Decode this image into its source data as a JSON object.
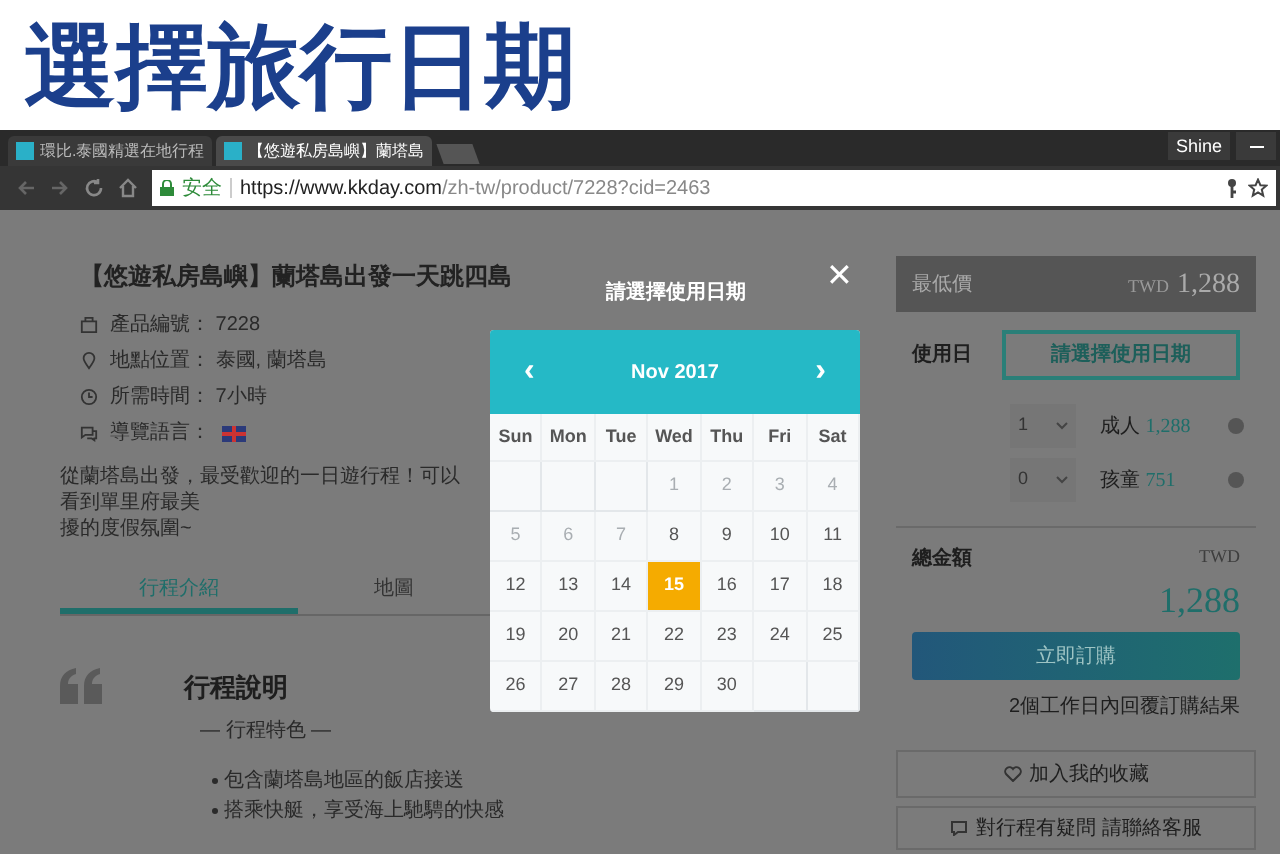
{
  "heading": "選擇旅行日期",
  "browser": {
    "tabs": [
      {
        "title": "環比.泰國精選在地行程",
        "selected": false
      },
      {
        "title": "【悠遊私房島嶼】蘭塔島",
        "selected": true
      }
    ],
    "profile": "Shine",
    "security_label": "安全",
    "url_host": "https://www.kkday.com",
    "url_path": "/zh-tw/product/7228?cid=2463"
  },
  "product": {
    "title": "【悠遊私房島嶼】蘭塔島出發一天跳四島",
    "info": [
      {
        "kind": "id",
        "text": "產品編號： 7228"
      },
      {
        "kind": "location",
        "text": "地點位置： 泰國, 蘭塔島"
      },
      {
        "kind": "duration",
        "text": "所需時間： 7小時"
      },
      {
        "kind": "language",
        "text": "導覽語言："
      }
    ],
    "description_lines": [
      "從蘭塔島出發，最受歡迎的一日遊行程！可以看到單里府最美",
      "擾的度假氛圍~"
    ],
    "tabs": [
      {
        "label": "行程介紹",
        "selected": true
      },
      {
        "label": "地圖",
        "selected": false
      }
    ],
    "section_title": "行程說明",
    "section_subtitle": "— 行程特色 —",
    "bullets": [
      "包含蘭塔島地區的飯店接送",
      "搭乘快艇，享受海上馳騁的快感"
    ]
  },
  "modal": {
    "title": "請選擇使用日期",
    "close": "✕",
    "prev": "‹",
    "next": "›",
    "month": "Nov 2017",
    "weekdays": [
      "Sun",
      "Mon",
      "Tue",
      "Wed",
      "Thu",
      "Fri",
      "Sat"
    ],
    "weeks": [
      [
        {
          "kind": "empty"
        },
        {
          "kind": "empty"
        },
        {
          "kind": "empty"
        },
        {
          "day": "1",
          "disabled": true,
          "selected": false
        },
        {
          "day": "2",
          "disabled": true,
          "selected": false
        },
        {
          "day": "3",
          "disabled": true,
          "selected": false
        },
        {
          "day": "4",
          "disabled": true,
          "selected": false
        }
      ],
      [
        {
          "day": "5",
          "disabled": true,
          "selected": false
        },
        {
          "day": "6",
          "disabled": true,
          "selected": false
        },
        {
          "day": "7",
          "disabled": true,
          "selected": false
        },
        {
          "day": "8",
          "disabled": false,
          "selected": false
        },
        {
          "day": "9",
          "disabled": false,
          "selected": false
        },
        {
          "day": "10",
          "disabled": false,
          "selected": false
        },
        {
          "day": "11",
          "disabled": false,
          "selected": false
        }
      ],
      [
        {
          "day": "12",
          "disabled": false,
          "selected": false
        },
        {
          "day": "13",
          "disabled": false,
          "selected": false
        },
        {
          "day": "14",
          "disabled": false,
          "selected": false
        },
        {
          "day": "15",
          "disabled": false,
          "selected": true
        },
        {
          "day": "16",
          "disabled": false,
          "selected": false
        },
        {
          "day": "17",
          "disabled": false,
          "selected": false
        },
        {
          "day": "18",
          "disabled": false,
          "selected": false
        }
      ],
      [
        {
          "day": "19",
          "disabled": false,
          "selected": false
        },
        {
          "day": "20",
          "disabled": false,
          "selected": false
        },
        {
          "day": "21",
          "disabled": false,
          "selected": false
        },
        {
          "day": "22",
          "disabled": false,
          "selected": false
        },
        {
          "day": "23",
          "disabled": false,
          "selected": false
        },
        {
          "day": "24",
          "disabled": false,
          "selected": false
        },
        {
          "day": "25",
          "disabled": false,
          "selected": false
        }
      ],
      [
        {
          "day": "26",
          "disabled": false,
          "selected": false
        },
        {
          "day": "27",
          "disabled": false,
          "selected": false
        },
        {
          "day": "28",
          "disabled": false,
          "selected": false
        },
        {
          "day": "29",
          "disabled": false,
          "selected": false
        },
        {
          "day": "30",
          "disabled": false,
          "selected": false
        },
        {
          "kind": "empty"
        },
        {
          "kind": "empty"
        }
      ]
    ]
  },
  "booking": {
    "lowest_label": "最低價",
    "lowest_currency": "TWD",
    "lowest_price": "1,288",
    "date_label": "使用日",
    "date_button": "請選擇使用日期",
    "quantities": [
      {
        "count": "1",
        "label": "成人",
        "price": "1,288"
      },
      {
        "count": "0",
        "label": "孩童",
        "price": "751"
      }
    ],
    "total_label": "總金額",
    "total_currency": "TWD",
    "total_price": "1,288",
    "order_button": "立即訂購",
    "reply_note": "2個工作日內回覆訂購結果",
    "favorite": "加入我的收藏",
    "contact": "對行程有疑問 請聯絡客服"
  }
}
